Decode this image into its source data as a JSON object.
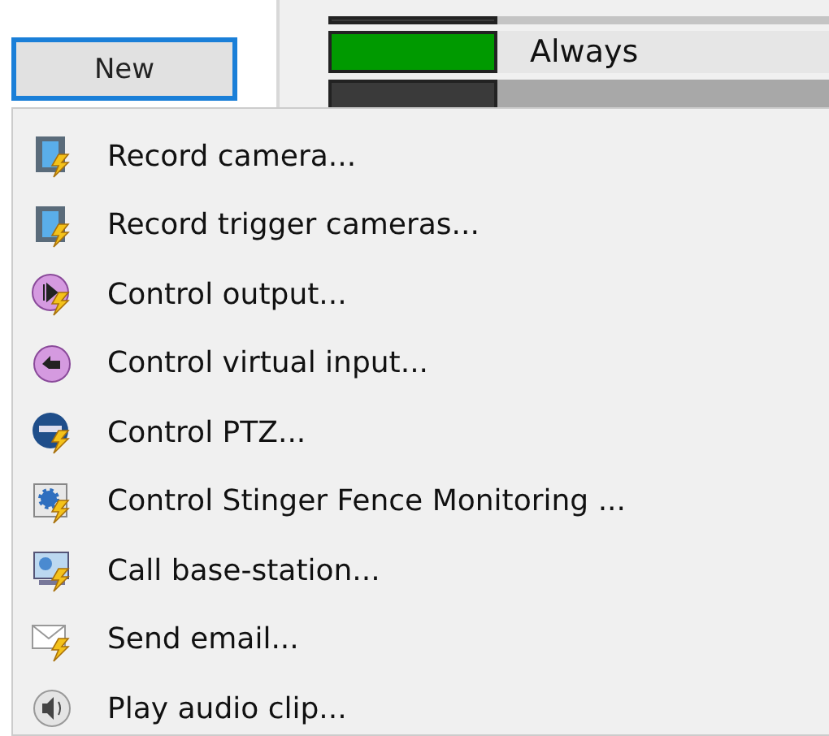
{
  "new_button": {
    "label": "New"
  },
  "schedule_rows": [
    {
      "color": "#3a3a3a",
      "kind": "clipped"
    },
    {
      "color": "#009a00",
      "kind": "plain",
      "label": "Always"
    },
    {
      "color": "#3a3a3a",
      "kind": "shaded"
    }
  ],
  "menu": {
    "items": [
      {
        "kind": "film",
        "label": "Record camera..."
      },
      {
        "kind": "film",
        "label": "Record trigger cameras..."
      },
      {
        "kind": "output",
        "label": "Control output..."
      },
      {
        "kind": "input",
        "label": "Control virtual input..."
      },
      {
        "kind": "ptz",
        "label": "Control PTZ..."
      },
      {
        "kind": "fence",
        "label": "Control Stinger Fence Monitoring ..."
      },
      {
        "kind": "station",
        "label": "Call base-station..."
      },
      {
        "kind": "email",
        "label": "Send email..."
      },
      {
        "kind": "audio",
        "label": "Play audio clip..."
      }
    ]
  }
}
